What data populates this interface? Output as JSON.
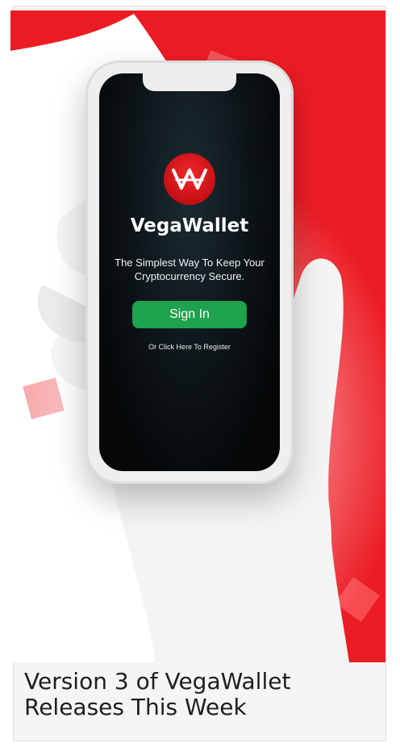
{
  "hero": {
    "brand_name": "VegaWallet",
    "tagline_line1": "The Simplest Way To Keep Your",
    "tagline_line2": "Cryptocurrency Secure.",
    "signin_label": "Sign In",
    "register_label": "Or Click Here To Register",
    "colors": {
      "brand_red": "#e3161b",
      "signin_green": "#1fa24d",
      "screen_dark": "#0d1519"
    },
    "icons": [
      "vegawallet-logo-icon"
    ]
  },
  "caption": {
    "line1": "Version 3 of VegaWallet",
    "line2": "Releases This Week"
  }
}
